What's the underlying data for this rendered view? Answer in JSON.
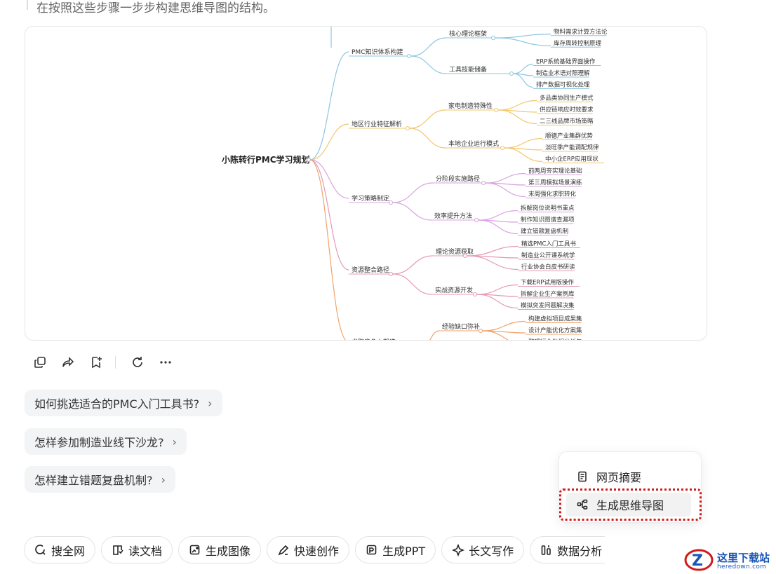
{
  "intro_text": "在按照这些步骤一步步构建思维导图的结构。",
  "mindmap": {
    "root": "小陈转行PMC学习规划",
    "branches": [
      {
        "label": "PMC知识体系构建",
        "color": "#8ec6e0",
        "children": [
          {
            "label": "核心理论框架",
            "leaves": [
              "物料需求计算方法论",
              "库存周转控制原理"
            ]
          },
          {
            "label": "工具技能储备",
            "leaves": [
              "ERP系统基础界面操作",
              "制造业术语对照理解",
              "排产数据可视化处理"
            ]
          }
        ]
      },
      {
        "label": "地区行业特征解析",
        "color": "#f2c66d",
        "children": [
          {
            "label": "家电制造特殊性",
            "leaves": [
              "多品类协同生产模式",
              "供应链响应时效要求",
              "二三线品牌市场策略"
            ]
          },
          {
            "label": "本地企业运行模式",
            "leaves": [
              "顺德产业集群优势",
              "淡旺季产能调配规律",
              "中小企ERP应用现状"
            ]
          }
        ]
      },
      {
        "label": "学习策略制定",
        "color": "#d7a3e0",
        "children": [
          {
            "label": "分阶段实施路径",
            "leaves": [
              "前两周夯实理论基础",
              "第三周模拟场景演练",
              "末周强化求职转化"
            ]
          },
          {
            "label": "效率提升方法",
            "leaves": [
              "拆解岗位说明书重点",
              "制作知识图谱查漏项",
              "建立错题复盘机制"
            ]
          }
        ]
      },
      {
        "label": "资源整合路径",
        "color": "#e59ab6",
        "children": [
          {
            "label": "理论资源获取",
            "leaves": [
              "精选PMC入门工具书",
              "制造业公开课系统学",
              "行业协会白皮书研读"
            ]
          },
          {
            "label": "实战资源开发",
            "leaves": [
              "下载ERP试用版操作",
              "拆解企业生产案例库",
              "模拟突发问题解决集"
            ]
          }
        ]
      },
      {
        "label": "求职竞争力塑造",
        "color": "#f0a36a",
        "children": [
          {
            "label": "经验缺口弥补",
            "leaves": [
              "构建虚拟项目成果集",
              "设计产能优化方案集",
              "整理行业数据分析包"
            ]
          }
        ]
      }
    ]
  },
  "action_icons": [
    "copy-icon",
    "share-icon",
    "bookmark-add-icon",
    "regenerate-icon",
    "more-icon"
  ],
  "suggestions": [
    "如何挑选适合的PMC入门工具书?",
    "怎样参加制造业线下沙龙?",
    "怎样建立错题复盘机制?"
  ],
  "popup": {
    "summary": "网页摘要",
    "mindmap": "生成思维导图"
  },
  "toolbar": [
    {
      "label": "搜全网",
      "icon": "search-icon"
    },
    {
      "label": "读文档",
      "icon": "book-icon"
    },
    {
      "label": "生成图像",
      "icon": "image-gen-icon"
    },
    {
      "label": "快速创作",
      "icon": "pen-icon"
    },
    {
      "label": "生成PPT",
      "icon": "ppt-icon"
    },
    {
      "label": "长文写作",
      "icon": "sparkle-icon"
    },
    {
      "label": "数据分析",
      "icon": "chart-icon"
    }
  ],
  "watermark": {
    "line1": "这里下载站",
    "line2": "heredown.com"
  },
  "colors": {
    "highlight": "#d11a1a",
    "watermark": "#1a56b8"
  }
}
